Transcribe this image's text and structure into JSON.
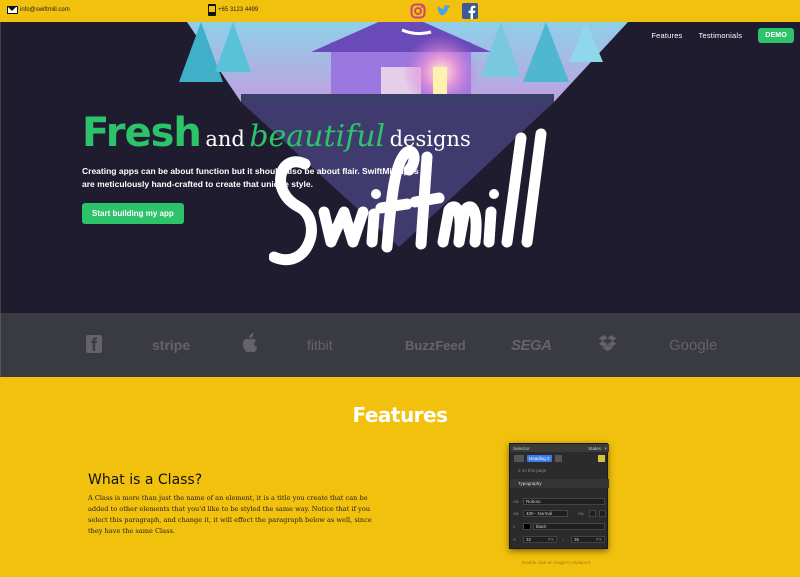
{
  "topbar": {
    "email": "info@swiftmill.com",
    "phone": "+65 3123 4499",
    "social": [
      {
        "icon": "instagram-icon",
        "color": "#c9457a"
      },
      {
        "icon": "twitter-icon",
        "color": "#4aa1e8"
      },
      {
        "icon": "facebook-icon",
        "color": "#3c5a98"
      }
    ]
  },
  "nav": {
    "items": [
      "Features",
      "Testimonials"
    ],
    "demo_label": "DEMO"
  },
  "hero": {
    "headline_1": "Fresh",
    "headline_2": "and",
    "headline_3": "beautiful",
    "headline_4": "designs",
    "lede": "Creating apps can be about function but it should also be about flair. SwiftMill apps are meticulously hand-crafted to create that unique style.",
    "cta_label": "Start building my app",
    "logo_text": "Swiftmill"
  },
  "logos": [
    "f",
    "stripe",
    "apple",
    "fitbit",
    "BuzzFeed",
    "SEGA",
    "dropbox",
    "Google"
  ],
  "features": {
    "title": "Features",
    "class_title": "What is a Class?",
    "class_text": "A Class is more than just the name of an element, it is a title you create that can be added to other elements that you'd like to be styled the same way. Notice that if you select this paragraph, and change it, it will effect the paragraph below as well, since they have the same Class.",
    "panel": {
      "selector_label": "Selector",
      "states_label": "States",
      "chip": "Heading 2",
      "on_page": "3 on this page",
      "typography": "Typography",
      "font": "Roboto",
      "weight": "400 - Normal",
      "color_name": "black",
      "size": "32",
      "line_height": "36",
      "size_unit": "PX"
    },
    "caption": "Double click an image to replace it"
  },
  "colors": {
    "yellow": "#f1c10d",
    "green": "#2dc36a",
    "hero_bg": "#201c30"
  }
}
